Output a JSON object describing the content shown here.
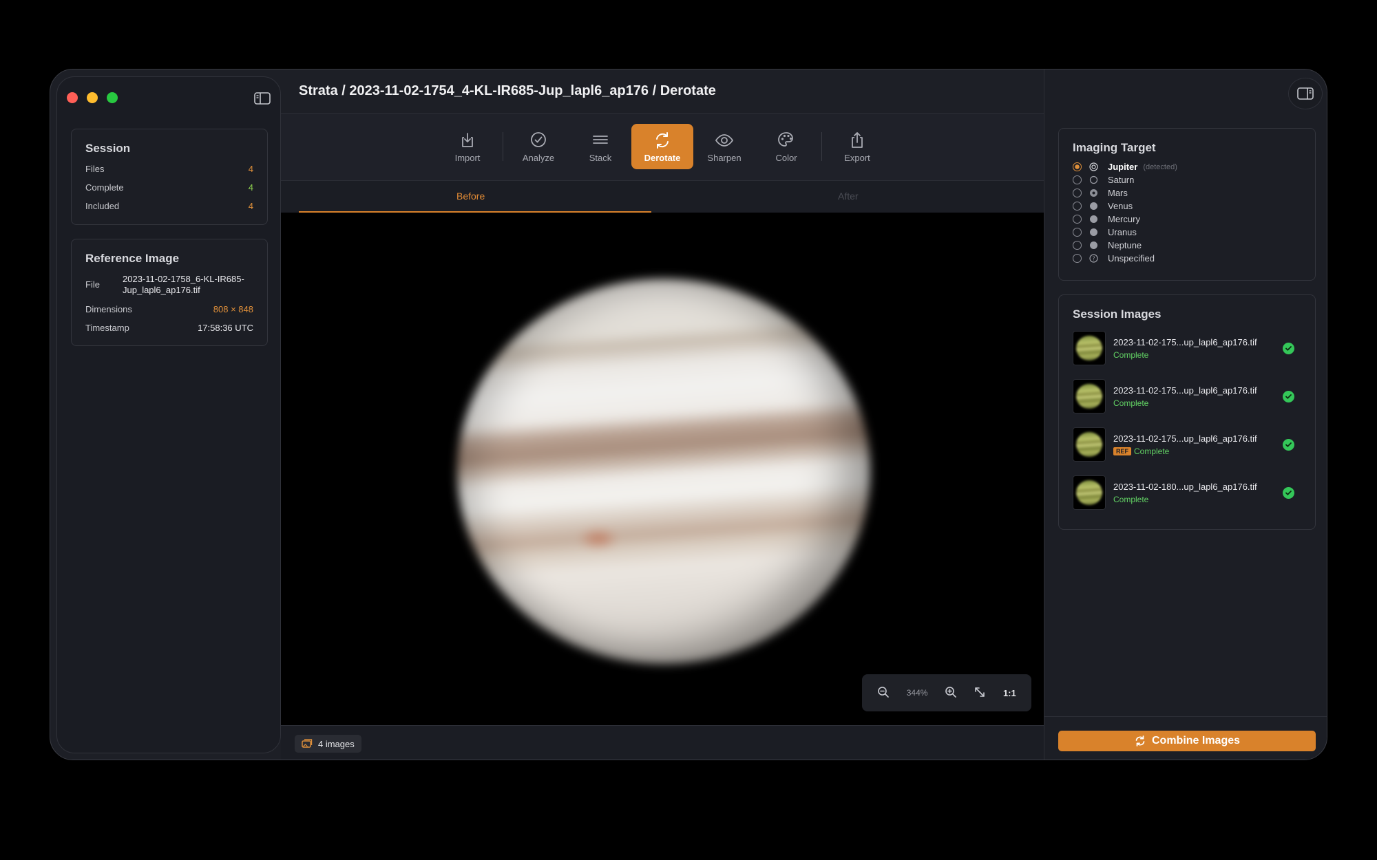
{
  "window": {
    "title": "Strata / 2023-11-02-1754_4-KL-IR685-Jup_lapl6_ap176 / Derotate"
  },
  "session": {
    "heading": "Session",
    "rows": [
      {
        "label": "Files",
        "value": "4"
      },
      {
        "label": "Complete",
        "value": "4"
      },
      {
        "label": "Included",
        "value": "4"
      }
    ]
  },
  "reference": {
    "heading": "Reference Image",
    "file_label": "File",
    "file_value": "2023-11-02-1758_6-KL-IR685-Jup_lapl6_ap176.tif",
    "dimensions_label": "Dimensions",
    "dimensions_value": "808 × 848",
    "timestamp_label": "Timestamp",
    "timestamp_value": "17:58:36 UTC"
  },
  "toolbar": {
    "tools": [
      {
        "label": "Import",
        "icon": "import-icon"
      },
      {
        "label": "Analyze",
        "icon": "checkmark-circle-icon"
      },
      {
        "label": "Stack",
        "icon": "stack-lines-icon"
      },
      {
        "label": "Derotate",
        "icon": "rotate-arrows-icon",
        "active": true
      },
      {
        "label": "Sharpen",
        "icon": "eye-icon"
      },
      {
        "label": "Color",
        "icon": "palette-icon"
      },
      {
        "label": "Export",
        "icon": "share-icon"
      }
    ]
  },
  "tabs": {
    "before": "Before",
    "after": "After"
  },
  "zoom": {
    "level": "344%",
    "actual_size": "1:1"
  },
  "status": {
    "image_count": "4 images"
  },
  "imaging_target": {
    "heading": "Imaging Target",
    "detected_note": "(detected)",
    "options": [
      "Jupiter",
      "Saturn",
      "Mars",
      "Venus",
      "Mercury",
      "Uranus",
      "Neptune",
      "Unspecified"
    ],
    "selected": "Jupiter"
  },
  "session_images": {
    "heading": "Session Images",
    "items": [
      {
        "name": "2023-11-02-175...up_lapl6_ap176.tif",
        "status": "Complete",
        "ref": false
      },
      {
        "name": "2023-11-02-175...up_lapl6_ap176.tif",
        "status": "Complete",
        "ref": false
      },
      {
        "name": "2023-11-02-175...up_lapl6_ap176.tif",
        "status": "Complete",
        "ref": true,
        "ref_label": "REF"
      },
      {
        "name": "2023-11-02-180...up_lapl6_ap176.tif",
        "status": "Complete",
        "ref": false
      }
    ]
  },
  "actions": {
    "combine": "Combine Images"
  },
  "colors": {
    "accent": "#d9822b",
    "complete_green": "#62d264",
    "background": "#1d1f26"
  }
}
